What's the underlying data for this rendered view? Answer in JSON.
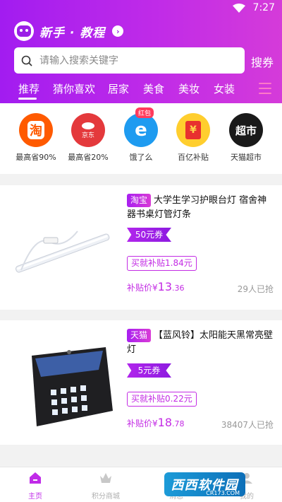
{
  "status": {
    "time": "7:27"
  },
  "header": {
    "tutorial_label": "新手 · 教程",
    "search_placeholder": "请输入搜索关键字",
    "search_button": "搜券"
  },
  "tabs": [
    {
      "label": "推荐",
      "active": true
    },
    {
      "label": "猜你喜欢"
    },
    {
      "label": "居家"
    },
    {
      "label": "美食"
    },
    {
      "label": "美妆"
    },
    {
      "label": "女装"
    }
  ],
  "categories": [
    {
      "icon": "淘",
      "label": "最高省90%",
      "color": "#ff5a00"
    },
    {
      "icon": "京东",
      "label": "最高省20%",
      "color": "#e4393c"
    },
    {
      "icon": "e",
      "label": "饿了么",
      "color": "#1e9bf0",
      "badge": "红包"
    },
    {
      "icon": "¥",
      "label": "百亿补贴",
      "color": "#ffce2e"
    },
    {
      "icon": "超市",
      "label": "天猫超市",
      "color": "#1a1a1a"
    }
  ],
  "products": [
    {
      "platform": "淘宝",
      "title": "大学生学习护眼台灯 宿舍神器书桌灯管灯条",
      "coupon": "50元券",
      "subsidy": "买就补贴1.84元",
      "price_label": "补贴价¥",
      "price_int": "13",
      "price_dec": ".36",
      "sold": "29人已抢"
    },
    {
      "platform": "天猫",
      "title": "【蓝风铃】太阳能天黑常亮壁灯",
      "coupon": "5元券",
      "subsidy": "买就补贴0.22元",
      "price_label": "补贴价¥",
      "price_int": "18",
      "price_dec": ".78",
      "sold": "38407人已抢"
    }
  ],
  "bottom_nav": [
    {
      "label": "主页",
      "active": true
    },
    {
      "label": "积分商城"
    },
    {
      "label": "消息"
    },
    {
      "label": "我的"
    }
  ],
  "watermark": {
    "text": "西西软件园",
    "sub": "CR173.COM"
  },
  "colors": {
    "accent": "#c02be8",
    "gradient_start": "#a21cf0",
    "gradient_end": "#d53bd9"
  }
}
